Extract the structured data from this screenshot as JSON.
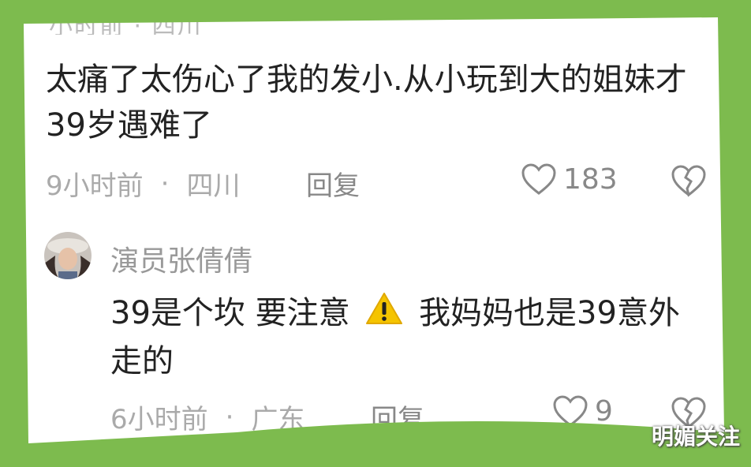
{
  "cut_off_text": "小时前 · 四川",
  "comment1": {
    "body": "太痛了太伤心了我的发小.从小玩到大的姐妹才39岁遇难了",
    "time": "9小时前",
    "location": "四川",
    "reply_label": "回复",
    "likes": "183"
  },
  "comment2": {
    "username": "演员张倩倩",
    "body_part1": "39是个坎 要注意",
    "body_part2": "我妈妈也是39意外走的",
    "time": "6小时前",
    "location": "广东",
    "reply_label": "回复",
    "likes": "9"
  },
  "separator": "·",
  "watermark": "明媚关注",
  "colors": {
    "border_green": "#7dbb4e",
    "text_primary": "#222222",
    "text_muted": "#aaaaaa"
  },
  "icons": [
    "heart-icon",
    "broken-heart-icon",
    "warning-icon"
  ]
}
